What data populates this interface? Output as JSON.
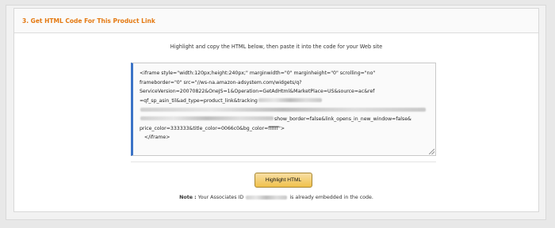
{
  "section": {
    "title": "3. Get HTML Code For This Product Link",
    "instruction": "Highlight and copy the HTML below, then paste it into the code for your Web site"
  },
  "code": {
    "line1": "<iframe style=\"width:120px;height:240px;\" marginwidth=\"0\" marginheight=\"0\" scrolling=\"no\"",
    "line2": "frameborder=\"0\" src=\"//ws-na.amazon-adsystem.com/widgets/q?",
    "line3": "ServiceVersion=20070822&OneJS=1&Operation=GetAdHtml&MarketPlace=US&source=ac&ref",
    "line4": "=qf_sp_asin_til&ad_type=product_link&tracking",
    "line6_tail": "show_border=false&link_opens_in_new_window=false&",
    "line7": "price_color=333333&title_color=0066c0&bg_color=ffffff\">",
    "line8": "</iframe>"
  },
  "button": {
    "label": "Highlight HTML"
  },
  "note": {
    "label": "Note :",
    "before": "Your Associates ID",
    "after": "is already embedded in the code."
  }
}
